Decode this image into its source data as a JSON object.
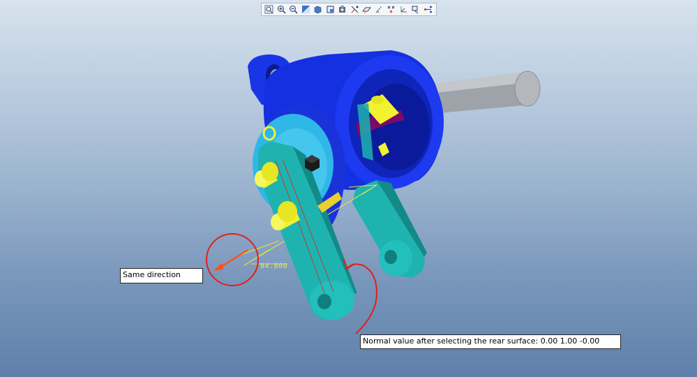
{
  "toolbar": {
    "buttons": [
      {
        "name": "zoom-fit-button",
        "icon": "zoom-fit-icon"
      },
      {
        "name": "zoom-in-button",
        "icon": "zoom-in-icon"
      },
      {
        "name": "zoom-out-button",
        "icon": "zoom-out-icon"
      },
      {
        "name": "repaint-button",
        "icon": "repaint-icon"
      },
      {
        "name": "shading-button",
        "icon": "shading-icon"
      },
      {
        "name": "saved-views-button",
        "icon": "saved-views-icon"
      },
      {
        "name": "view-manager-button",
        "icon": "view-manager-icon"
      },
      {
        "name": "datum-display-button",
        "icon": "datum-display-icon"
      },
      {
        "name": "plane-display-button",
        "icon": "plane-display-icon"
      },
      {
        "name": "axis-display-button",
        "icon": "axis-display-icon"
      },
      {
        "name": "point-display-button",
        "icon": "point-display-icon"
      },
      {
        "name": "csys-display-button",
        "icon": "csys-display-icon"
      },
      {
        "name": "annotation-display-button",
        "icon": "annotation-display-icon"
      },
      {
        "name": "spin-center-button",
        "icon": "spin-center-icon"
      }
    ]
  },
  "annotations": {
    "same_direction": "Same direction",
    "normal_value": "Normal value after selecting the rear surface: 0.00 1.00 -0.00"
  },
  "dimension": {
    "value": "84.800"
  },
  "colors": {
    "housing": "#1530e0",
    "housing_dark": "#0a1aa8",
    "link": "#1fb3b0",
    "link_dark": "#128a88",
    "pin": "#f2f230",
    "shaft": "#a8adb3",
    "cam": "#7a0a6a",
    "disc": "#2fb7e8",
    "markup_red": "#e0201a"
  }
}
